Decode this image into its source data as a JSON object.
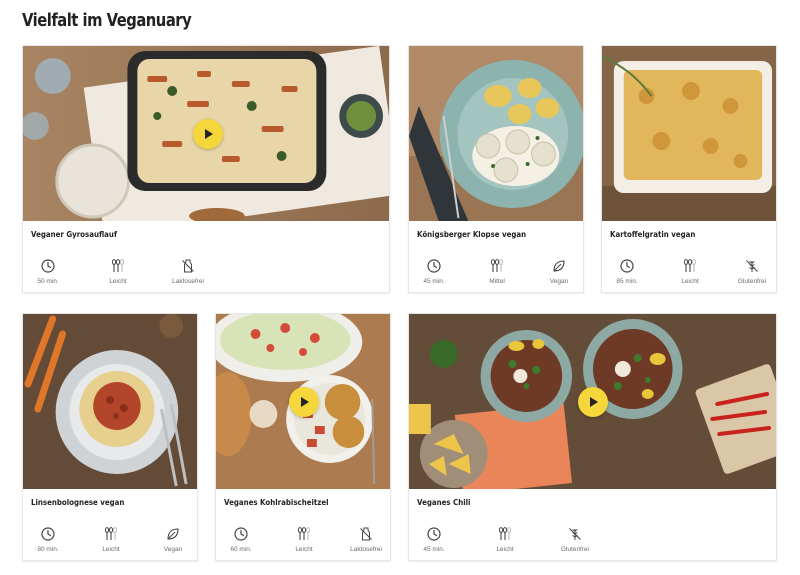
{
  "page": {
    "title": "Vielfalt im Veganuary"
  },
  "colors": {
    "play_button": "#f5d63b",
    "icon_stroke": "#444444"
  },
  "recipes": [
    {
      "title": "Veganer Gyrosauflauf",
      "has_video": true,
      "meta": [
        {
          "icon": "clock-icon",
          "label": "50 min."
        },
        {
          "icon": "difficulty-spoons-icon",
          "label": "Leicht"
        },
        {
          "icon": "lactose-free-icon",
          "label": "Laktosefrei"
        }
      ]
    },
    {
      "title": "Königsberger Klopse vegan",
      "has_video": false,
      "meta": [
        {
          "icon": "clock-icon",
          "label": "45 min."
        },
        {
          "icon": "difficulty-spoons-icon",
          "label": "Mittel"
        },
        {
          "icon": "vegan-leaf-icon",
          "label": "Vegan"
        }
      ]
    },
    {
      "title": "Kartoffelgratin vegan",
      "has_video": false,
      "meta": [
        {
          "icon": "clock-icon",
          "label": "85 min."
        },
        {
          "icon": "difficulty-spoons-icon",
          "label": "Leicht"
        },
        {
          "icon": "gluten-free-icon",
          "label": "Glutenfrei"
        }
      ]
    },
    {
      "title": "Linsenbolognese vegan",
      "has_video": false,
      "meta": [
        {
          "icon": "clock-icon",
          "label": "80 min."
        },
        {
          "icon": "difficulty-spoons-icon",
          "label": "Leicht"
        },
        {
          "icon": "vegan-leaf-icon",
          "label": "Vegan"
        }
      ]
    },
    {
      "title": "Veganes Kohlrabischeitzel",
      "has_video": true,
      "meta": [
        {
          "icon": "clock-icon",
          "label": "60 min."
        },
        {
          "icon": "difficulty-spoons-icon",
          "label": "Leicht"
        },
        {
          "icon": "lactose-free-icon",
          "label": "Laktosefrei"
        }
      ]
    },
    {
      "title": "Veganes Chili",
      "has_video": true,
      "meta": [
        {
          "icon": "clock-icon",
          "label": "45 min."
        },
        {
          "icon": "difficulty-spoons-icon",
          "label": "Leicht"
        },
        {
          "icon": "gluten-free-icon",
          "label": "Glutenfrei"
        }
      ]
    }
  ]
}
